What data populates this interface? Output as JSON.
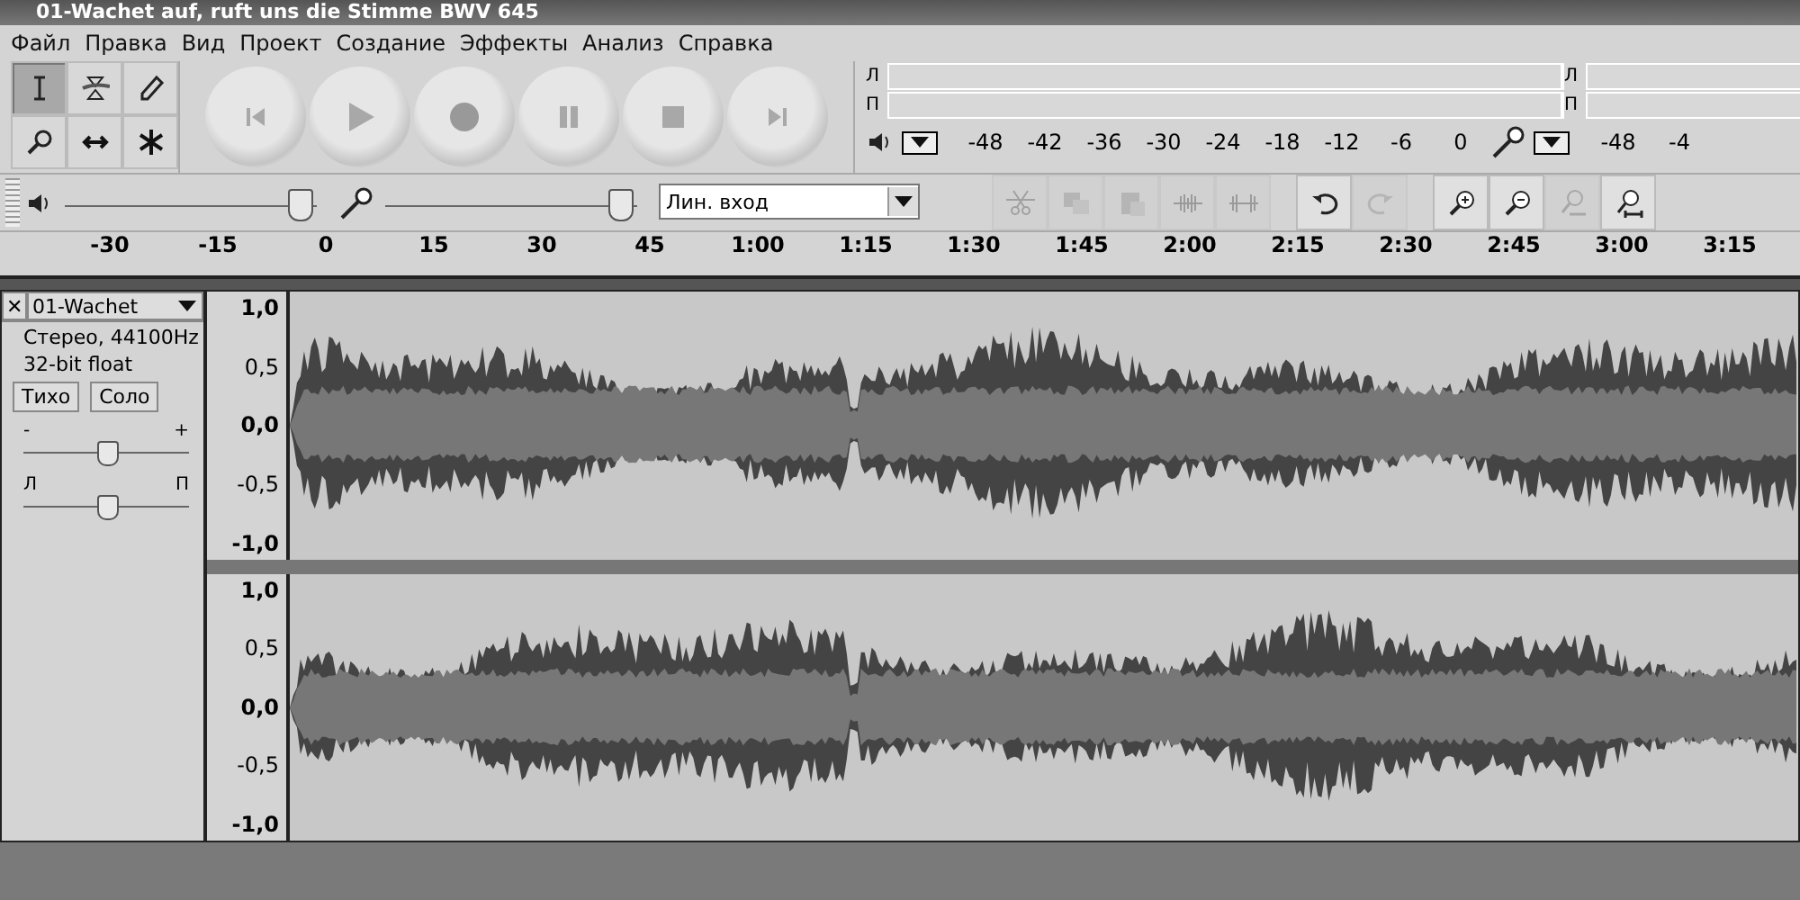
{
  "window": {
    "title": "01-Wachet auf, ruft uns die Stimme BWV 645"
  },
  "menu": [
    "Файл",
    "Правка",
    "Вид",
    "Проект",
    "Создание",
    "Эффекты",
    "Анализ",
    "Справка"
  ],
  "tools": [
    {
      "kind": "select",
      "selected": true
    },
    {
      "kind": "envelope",
      "selected": false
    },
    {
      "kind": "draw",
      "selected": false
    },
    {
      "kind": "zoom",
      "selected": false
    },
    {
      "kind": "timeshift",
      "selected": false
    },
    {
      "kind": "multi",
      "selected": false
    }
  ],
  "transport": [
    {
      "kind": "rewind"
    },
    {
      "kind": "play"
    },
    {
      "kind": "record"
    },
    {
      "kind": "pause"
    },
    {
      "kind": "stop"
    },
    {
      "kind": "forward"
    }
  ],
  "meters": [
    {
      "kind": "output",
      "channels": [
        "Л",
        "П"
      ]
    },
    {
      "kind": "input",
      "channels": [
        "Л",
        "П"
      ]
    }
  ],
  "meter_scale": [
    "-48",
    "-42",
    "-36",
    "-30",
    "-24",
    "-18",
    "-12",
    "-6",
    "0"
  ],
  "meter_scale_input": [
    "-48",
    "-4"
  ],
  "mixer": {
    "output": {
      "level": 0.93
    },
    "input": {
      "level": 0.93
    },
    "input_source": "Лин. вход"
  },
  "edit_groups": [
    [
      {
        "kind": "cut",
        "disabled": true
      },
      {
        "kind": "copy",
        "disabled": true
      },
      {
        "kind": "paste",
        "disabled": true
      },
      {
        "kind": "trim",
        "disabled": true
      },
      {
        "kind": "silence",
        "disabled": true
      }
    ],
    [
      {
        "kind": "undo",
        "disabled": false
      },
      {
        "kind": "redo",
        "disabled": true
      }
    ],
    [
      {
        "kind": "zoom_in",
        "disabled": false
      },
      {
        "kind": "zoom_out",
        "disabled": false
      },
      {
        "kind": "fit_selection",
        "disabled": true
      },
      {
        "kind": "fit",
        "disabled": false
      }
    ]
  ],
  "ruler": [
    "-30",
    "-15",
    "0",
    "15",
    "30",
    "45",
    "1:00",
    "1:15",
    "1:30",
    "1:45",
    "2:00",
    "2:15",
    "2:30",
    "2:45",
    "3:00",
    "3:15"
  ],
  "track": {
    "close": "✕",
    "name": "01-Wachet",
    "info": [
      "Стерео, 44100Hz",
      "32-bit float"
    ],
    "buttons": [
      "Тихо",
      "Соло"
    ],
    "gain": {
      "minus": "-",
      "plus": "+",
      "level": 0.5
    },
    "pan": {
      "left": "Л",
      "right": "П",
      "level": 0.5
    },
    "channels": [
      {
        "scale": [
          "1,0",
          "0,5",
          "0,0",
          "-0,5",
          "-1,0"
        ]
      },
      {
        "scale": [
          "1,0",
          "0,5",
          "0,0",
          "-0,5",
          "-1,0"
        ]
      }
    ]
  }
}
